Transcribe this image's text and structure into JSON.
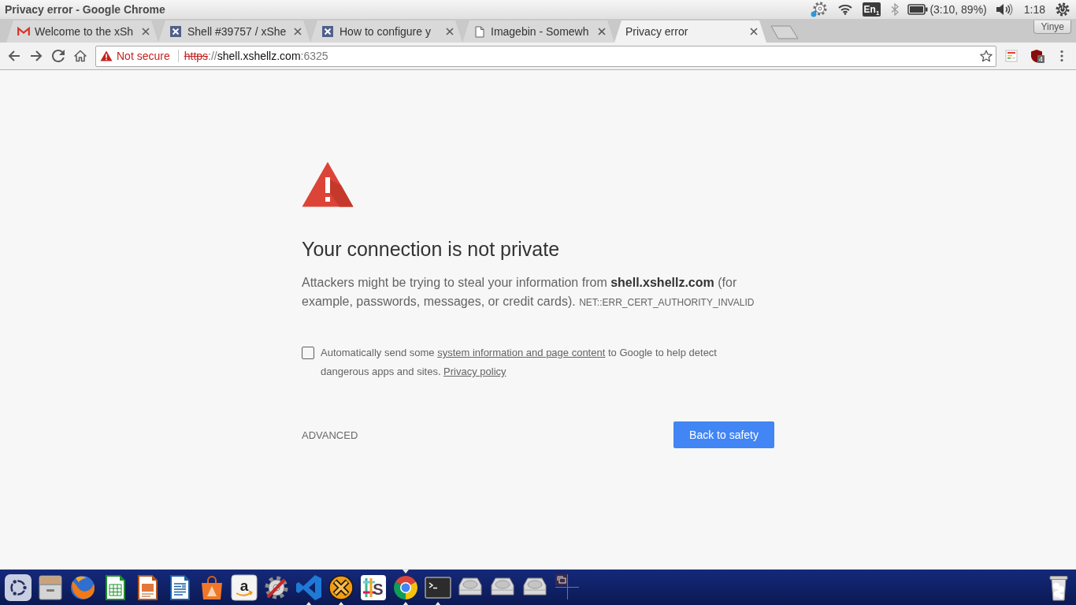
{
  "top_panel": {
    "window_title": "Privacy error - Google Chrome",
    "keyboard_layout": "En$_{1}$",
    "battery_status": "(3:10, 89%)",
    "clock": "1:18"
  },
  "tabs": [
    {
      "kind": "mail",
      "label": "Welcome to the xSh",
      "selected": false
    },
    {
      "kind": "x-tile",
      "label": "Shell #39757 / xShe",
      "selected": false
    },
    {
      "kind": "x-tile",
      "label": "How to configure y",
      "selected": false
    },
    {
      "kind": "page",
      "label": "Imagebin - Somewh",
      "selected": false
    },
    {
      "kind": "plain",
      "label": "Privacy error",
      "selected": true
    }
  ],
  "profile_button": "Yinye",
  "address_bar": {
    "secure": false,
    "security_label": "Not secure",
    "scheme": "https",
    "separator": "://",
    "host": "shell.xshellz.com",
    "port": ":6325"
  },
  "extension_badge": "4",
  "page": {
    "heading": "Your connection is not private",
    "paragraph": "Attackers might be trying to steal your information from **shell.xshellz.com** (for example, passwords, messages, or credit cards).",
    "error_code": "NET::ERR_CERT_AUTHORITY_INVALID",
    "consent": {
      "checked": false,
      "text_before": "Automatically send some",
      "link": "system information and page content",
      "text_after": "to Google to help detect dangerous apps and sites.",
      "policy_link": "Privacy policy"
    },
    "advanced_button": "ADVANCED",
    "primary_button": "Back to safety"
  },
  "launcher": [
    {
      "kind": "dash",
      "running": false,
      "focused": false
    },
    {
      "kind": "cabinet",
      "running": false,
      "focused": false
    },
    {
      "kind": "fox-globe",
      "running": false,
      "focused": false
    },
    {
      "kind": "spreadsheet",
      "running": false,
      "focused": false
    },
    {
      "kind": "slides",
      "running": false,
      "focused": false
    },
    {
      "kind": "doc",
      "running": false,
      "focused": false
    },
    {
      "kind": "bag",
      "running": false,
      "focused": false
    },
    {
      "kind": "letter-tile",
      "glyph": "a",
      "running": false,
      "focused": false
    },
    {
      "kind": "wrench-gear",
      "running": false,
      "focused": false
    },
    {
      "kind": "ribbon",
      "running": true,
      "focused": false
    },
    {
      "kind": "x-ball",
      "running": true,
      "focused": false
    },
    {
      "kind": "hash-tile",
      "glyph": "S",
      "running": false,
      "focused": false
    },
    {
      "kind": "segmented-circle",
      "running": true,
      "focused": true
    },
    {
      "kind": "terminal",
      "running": true,
      "focused": false
    },
    {
      "kind": "drive",
      "running": false,
      "focused": false
    },
    {
      "kind": "drive",
      "running": false,
      "focused": false
    },
    {
      "kind": "drive",
      "running": false,
      "focused": false
    }
  ]
}
